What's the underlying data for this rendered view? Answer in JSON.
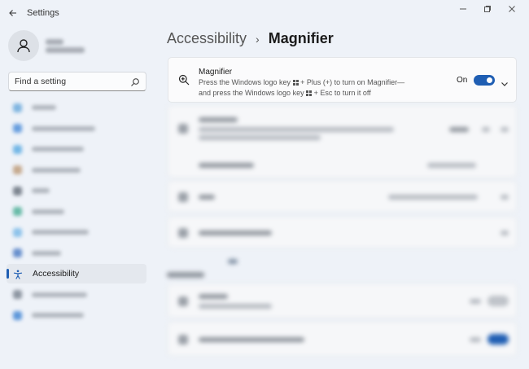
{
  "window": {
    "title": "Settings",
    "back_icon": "back-arrow-icon",
    "controls": [
      "minimize-icon",
      "restore-icon",
      "close-icon"
    ]
  },
  "sidebar": {
    "avatar_icon": "user-avatar-icon",
    "search": {
      "placeholder": "Find a setting",
      "icon": "search-icon"
    },
    "active_item": {
      "label": "Accessibility",
      "icon": "accessibility-icon"
    }
  },
  "breadcrumb": {
    "parent": "Accessibility",
    "separator": "›",
    "current": "Magnifier"
  },
  "magnifier_card": {
    "icon": "magnifier-icon",
    "title": "Magnifier",
    "desc_line1_a": "Press the Windows logo key",
    "desc_line1_b": "+ Plus (+) to turn on Magnifier—",
    "desc_line2_a": "and press the Windows logo key",
    "desc_line2_b": "+ Esc to turn it off",
    "state_label": "On",
    "toggle_on": true,
    "expand_icon": "chevron-down-icon"
  },
  "colors": {
    "accent": "#1f5eb3",
    "background": "#eef2f8",
    "card": "#fbfbfc"
  }
}
